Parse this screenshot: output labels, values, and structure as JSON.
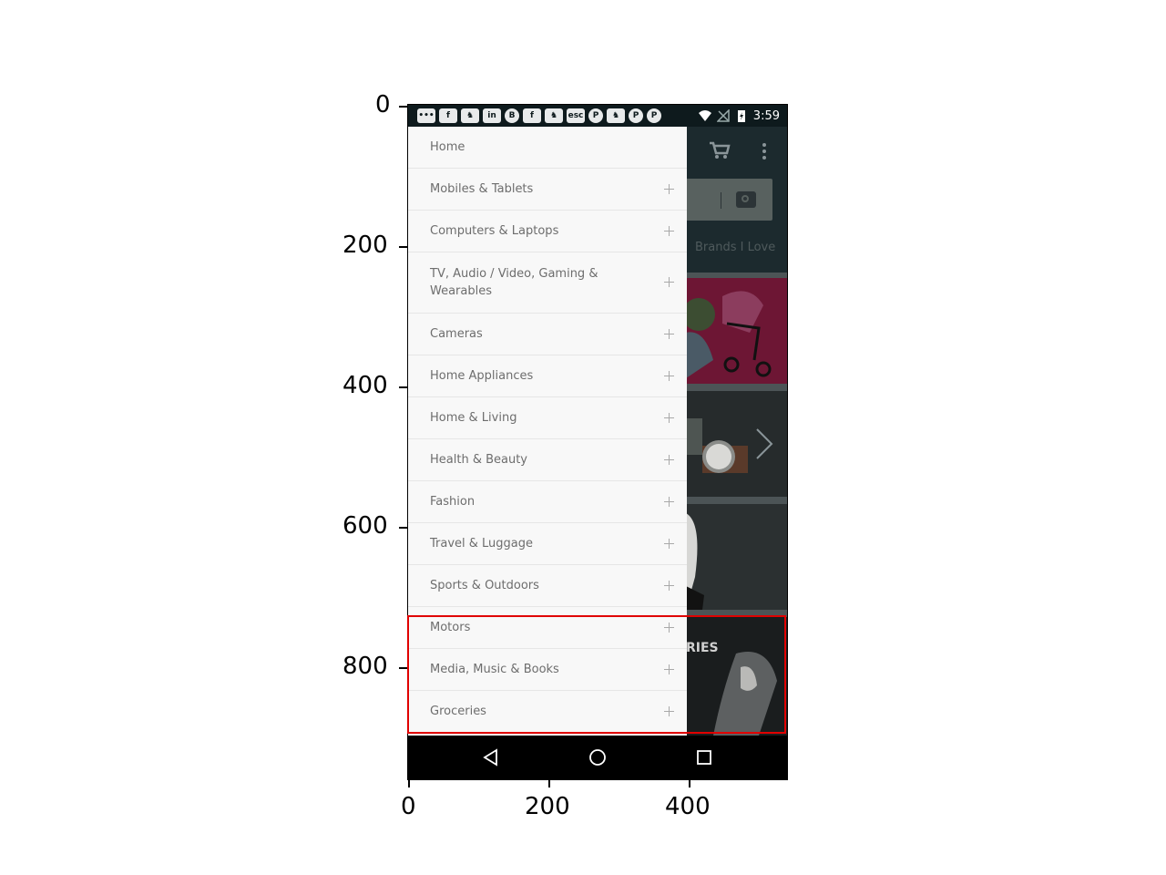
{
  "axes": {
    "y_ticks": [
      "0",
      "200",
      "400",
      "600",
      "800"
    ],
    "x_ticks": [
      "0",
      "200",
      "400"
    ]
  },
  "status_bar": {
    "time": "3:59",
    "notification_icons": [
      "message-icon",
      "facebook-icon",
      "game-icon",
      "linkedin-icon",
      "b-icon",
      "facebook-icon",
      "game-icon",
      "esc-icon",
      "pinterest-icon",
      "game-icon",
      "pinterest-icon",
      "pinterest-icon"
    ],
    "system_icons": [
      "wifi-icon",
      "no-signal-icon",
      "battery-charging-icon"
    ]
  },
  "background": {
    "brands_text": "Brands I Love",
    "banner_text": "RIES"
  },
  "drawer": {
    "items": [
      {
        "label": "Home"
      },
      {
        "label": "Mobiles & Tablets"
      },
      {
        "label": "Computers & Laptops"
      },
      {
        "label": "TV, Audio / Video, Gaming & Wearables"
      },
      {
        "label": "Cameras"
      },
      {
        "label": "Home Appliances"
      },
      {
        "label": "Home & Living"
      },
      {
        "label": "Health & Beauty"
      },
      {
        "label": "Fashion"
      },
      {
        "label": "Travel & Luggage"
      },
      {
        "label": "Sports & Outdoors"
      },
      {
        "label": "Motors"
      },
      {
        "label": "Media, Music & Books"
      },
      {
        "label": "Groceries"
      }
    ]
  },
  "nav_bar": {
    "buttons": [
      "back-icon",
      "home-icon",
      "recents-icon"
    ]
  },
  "colors": {
    "highlight": "#e00000",
    "drawer_bg": "#f8f8f8",
    "status_bar_bg": "#0e1a1d"
  }
}
